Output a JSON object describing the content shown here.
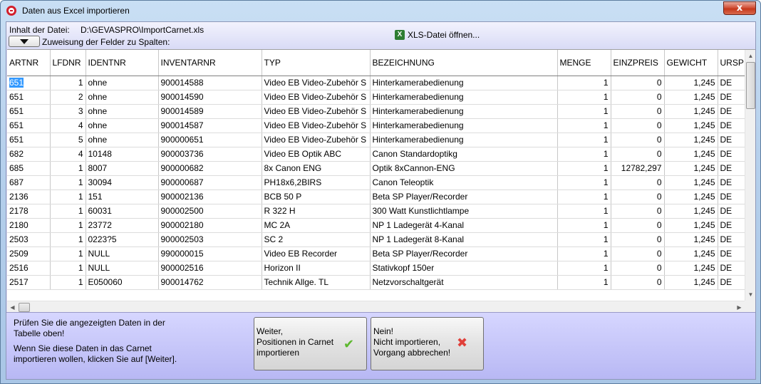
{
  "window": {
    "title": "Daten aus Excel importieren",
    "close_glyph": "x"
  },
  "file": {
    "label": "Inhalt der Datei:",
    "path": "D:\\GEVASPRO\\ImportCarnet.xls",
    "open_label": "XLS-Datei öffnen...",
    "assign_label": "Zuweisung der Felder zu Spalten:"
  },
  "table": {
    "columns": [
      "ARTNR",
      "LFDNR",
      "IDENTNR",
      "INVENTARNR",
      "TYP",
      "BEZEICHNUNG",
      "MENGE",
      "EINZPREIS",
      "GEWICHT",
      "URSP"
    ],
    "rows": [
      [
        "651",
        "1",
        "ohne",
        "900014588",
        "Video EB Video-Zubehör S",
        "Hinterkamerabedienung",
        "1",
        "0",
        "1,245",
        "DE"
      ],
      [
        "651",
        "2",
        "ohne",
        "900014590",
        "Video EB Video-Zubehör S",
        "Hinterkamerabedienung",
        "1",
        "0",
        "1,245",
        "DE"
      ],
      [
        "651",
        "3",
        "ohne",
        "900014589",
        "Video EB Video-Zubehör S",
        "Hinterkamerabedienung",
        "1",
        "0",
        "1,245",
        "DE"
      ],
      [
        "651",
        "4",
        "ohne",
        "900014587",
        "Video EB Video-Zubehör S",
        "Hinterkamerabedienung",
        "1",
        "0",
        "1,245",
        "DE"
      ],
      [
        "651",
        "5",
        "ohne",
        "900000651",
        "Video EB Video-Zubehör S",
        "Hinterkamerabedienung",
        "1",
        "0",
        "1,245",
        "DE"
      ],
      [
        "682",
        "4",
        "10148",
        "900003736",
        "Video EB Optik ABC",
        "Canon Standardoptikg",
        "1",
        "0",
        "1,245",
        "DE"
      ],
      [
        "685",
        "1",
        "8007",
        "900000682",
        "8x Canon ENG",
        "Optik 8xCannon-ENG",
        "1",
        "12782,297",
        "1,245",
        "DE"
      ],
      [
        "687",
        "1",
        "30094",
        "900000687",
        "PH18x6,2BIRS",
        "Canon Teleoptik",
        "1",
        "0",
        "1,245",
        "DE"
      ],
      [
        "2136",
        "1",
        "151",
        "900002136",
        "BCB 50 P",
        "Beta SP Player/Recorder",
        "1",
        "0",
        "1,245",
        "DE"
      ],
      [
        "2178",
        "1",
        "60031",
        "900002500",
        "R 322 H",
        "300 Watt Kunstlichtlampe",
        "1",
        "0",
        "1,245",
        "DE"
      ],
      [
        "2180",
        "1",
        "23772",
        "900002180",
        "MC 2A",
        "NP 1 Ladegerät 4-Kanal",
        "1",
        "0",
        "1,245",
        "DE"
      ],
      [
        "2503",
        "1",
        "0223?5",
        "900002503",
        "SC 2",
        "NP 1 Ladegerät 8-Kanal",
        "1",
        "0",
        "1,245",
        "DE"
      ],
      [
        "2509",
        "1",
        "NULL",
        "990000015",
        "Video EB Recorder",
        "Beta SP Player/Recorder",
        "1",
        "0",
        "1,245",
        "DE"
      ],
      [
        "2516",
        "1",
        "NULL",
        "900002516",
        "Horizon II",
        "Stativkopf 150er",
        "1",
        "0",
        "1,245",
        "DE"
      ],
      [
        "2517",
        "1",
        "E050060",
        "900014762",
        "Technik Allge. TL",
        "Netzvorschaltgerät",
        "1",
        "0",
        "1,245",
        "DE"
      ]
    ]
  },
  "hints": {
    "check": "Prüfen Sie die angezeigten Daten in der Tabelle oben!",
    "continue": "Wenn Sie diese Daten in das Carnet importieren wollen, klicken Sie auf [Weiter]."
  },
  "buttons": {
    "weiter": [
      "Weiter,",
      "Positionen in Carnet",
      "importieren"
    ],
    "nein": [
      "Nein!",
      "Nicht importieren,",
      "Vorgang abbrechen!"
    ]
  },
  "icons": {
    "check": "check-icon",
    "cancel": "cross-icon",
    "xls": "xls-icon"
  }
}
